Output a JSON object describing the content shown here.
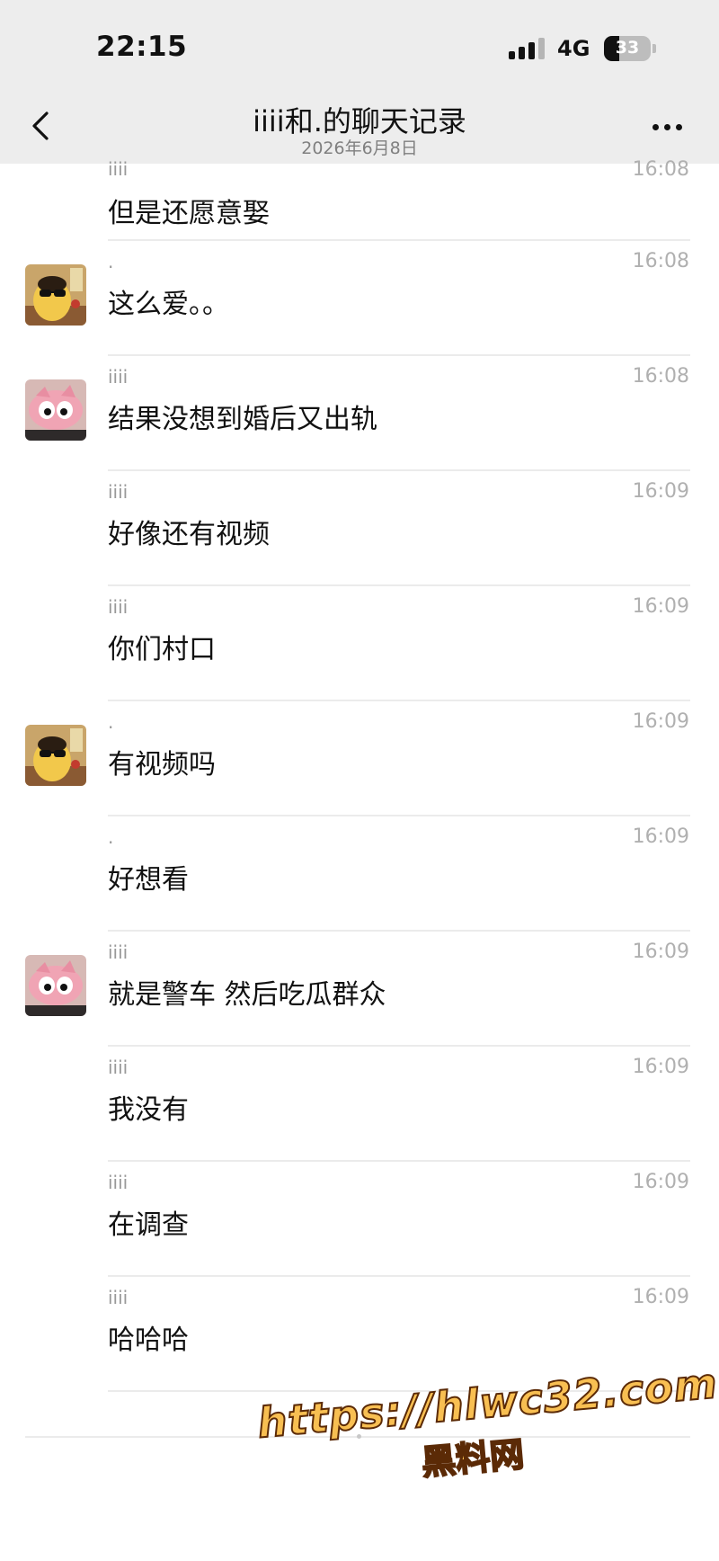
{
  "status_bar": {
    "time": "22:15",
    "network": "4G",
    "battery": "33",
    "battery_level": 0.33
  },
  "nav": {
    "title": "iiii和.的聊天记录",
    "date": "2026年6月8日",
    "back_icon": "chevron-left-icon",
    "more_icon": "more-icon"
  },
  "messages": [
    {
      "sender": "iiii",
      "time": "16:08",
      "text": "但是还愿意娶",
      "avatar": ""
    },
    {
      "sender": ".",
      "time": "16:08",
      "text": "这么爱。。",
      "avatar": "dot"
    },
    {
      "sender": "iiii",
      "time": "16:08",
      "text": "结果没想到婚后又出轨",
      "avatar": "iiii"
    },
    {
      "sender": "iiii",
      "time": "16:09",
      "text": "好像还有视频",
      "avatar": ""
    },
    {
      "sender": "iiii",
      "time": "16:09",
      "text": "你们村口",
      "avatar": ""
    },
    {
      "sender": ".",
      "time": "16:09",
      "text": "有视频吗",
      "avatar": "dot"
    },
    {
      "sender": ".",
      "time": "16:09",
      "text": "好想看",
      "avatar": ""
    },
    {
      "sender": "iiii",
      "time": "16:09",
      "text": "就是警车 然后吃瓜群众",
      "avatar": "iiii"
    },
    {
      "sender": "iiii",
      "time": "16:09",
      "text": "我没有",
      "avatar": ""
    },
    {
      "sender": "iiii",
      "time": "16:09",
      "text": "在调查",
      "avatar": ""
    },
    {
      "sender": "iiii",
      "time": "16:09",
      "text": "哈哈哈",
      "avatar": ""
    }
  ],
  "watermark": {
    "url": "https://hlwc32.com",
    "name": "黑料网"
  }
}
